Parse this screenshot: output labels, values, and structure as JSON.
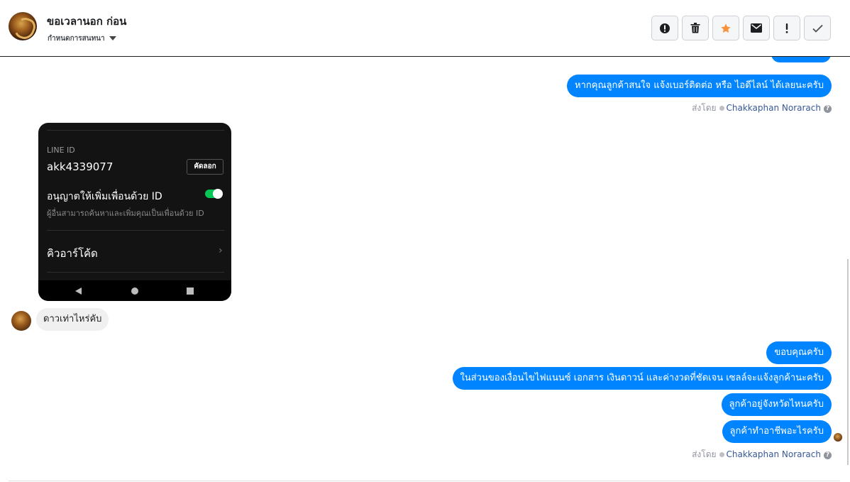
{
  "header": {
    "title": "ขอเวลานอก ก่อน",
    "subtitle": "กำหนดการสนทนา",
    "actions": [
      {
        "name": "report-button",
        "icon": "alert-circle-icon"
      },
      {
        "name": "delete-button",
        "icon": "trash-icon"
      },
      {
        "name": "star-button",
        "icon": "star-icon"
      },
      {
        "name": "mail-button",
        "icon": "envelope-icon"
      },
      {
        "name": "important-button",
        "icon": "exclamation-icon"
      },
      {
        "name": "done-button",
        "icon": "checkmark-icon"
      }
    ],
    "accent_star": "#f7923b"
  },
  "colors": {
    "outgoing_bubble": "#0084ff",
    "incoming_bubble": "#f1f0f0",
    "link": "#385898"
  },
  "thread": {
    "msg_top_partial": "",
    "msg_1": "หากคุณลูกค้าสนใจ แจ้งเบอร์ติดต่อ หรือ ไอดีไลน์ ได้เลยนะครับ",
    "sent_by_1": {
      "prefix": "ส่งโดย",
      "name": "Chakkaphan Norarach"
    },
    "screenshot": {
      "line_id_label": "LINE ID",
      "line_id_value": "akk4339077",
      "copy_label": "คัดลอก",
      "allow_title": "อนุญาตให้เพิ่มเพื่อนด้วย ID",
      "allow_desc": "ผู้อื่นสามารถค้นหาและเพิ่มคุณเป็นเพื่อนด้วย ID",
      "allow_enabled": true,
      "qr_label": "คิวอาร์โค้ด"
    },
    "incoming_1": "ดาวเท่าไหร่คับ",
    "msg_2": "ขอบคุณครับ",
    "msg_3": "ในส่วนของเงื่อนไขไฟแนนซ์ เอกสาร เงินดาวน์ และค่างวดที่ชัดเจน เซลล์จะแจ้งลูกค้านะครับ",
    "msg_4": "ลูกค้าอยู่จังหวัดไหนครับ",
    "msg_5": "ลูกค้าทำอาชีพอะไรครับ",
    "sent_by_2": {
      "prefix": "ส่งโดย",
      "name": "Chakkaphan Norarach"
    }
  }
}
